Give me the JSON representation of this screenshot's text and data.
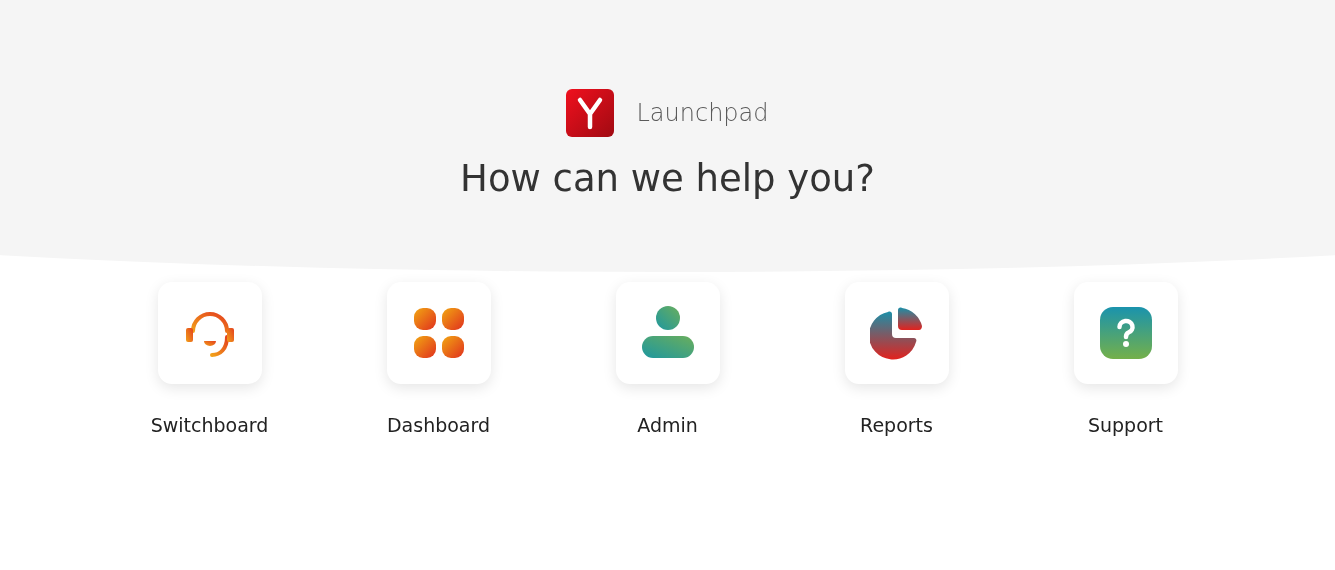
{
  "brand": {
    "name": "Launchpad"
  },
  "heading": "How can we help you?",
  "apps": [
    {
      "label": "Switchboard",
      "kind": "headset"
    },
    {
      "label": "Dashboard",
      "kind": "grid"
    },
    {
      "label": "Admin",
      "kind": "user"
    },
    {
      "label": "Reports",
      "kind": "pie"
    },
    {
      "label": "Support",
      "kind": "help"
    }
  ]
}
